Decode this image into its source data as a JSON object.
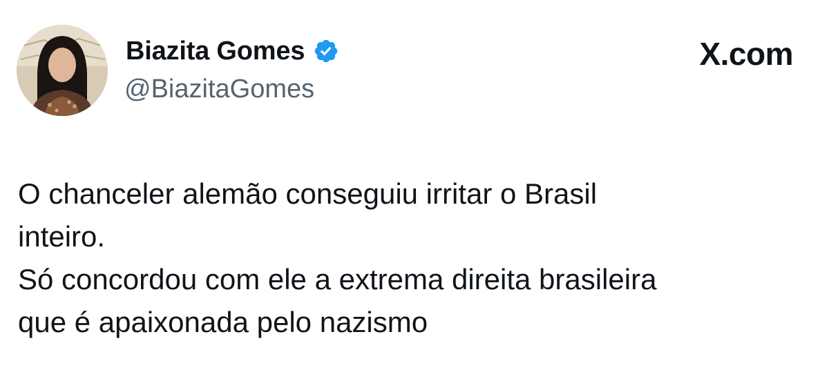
{
  "tweet": {
    "author": {
      "display_name": "Biazita Gomes",
      "handle": "@BiazitaGomes",
      "verified_icon": "verified-badge-icon",
      "avatar_icon": "profile-photo"
    },
    "brand": {
      "text": "X.com",
      "icon": "x-logo"
    },
    "body": {
      "lines": [
        "O chanceler alemão conseguiu irritar o Brasil",
        "inteiro.",
        "Só concordou com ele a extrema direita brasileira",
        "que é apaixonada pelo nazismo"
      ]
    }
  },
  "colors": {
    "text_primary": "#0f1419",
    "text_secondary": "#536471",
    "verified_blue": "#1d9bf0",
    "background": "#ffffff"
  }
}
